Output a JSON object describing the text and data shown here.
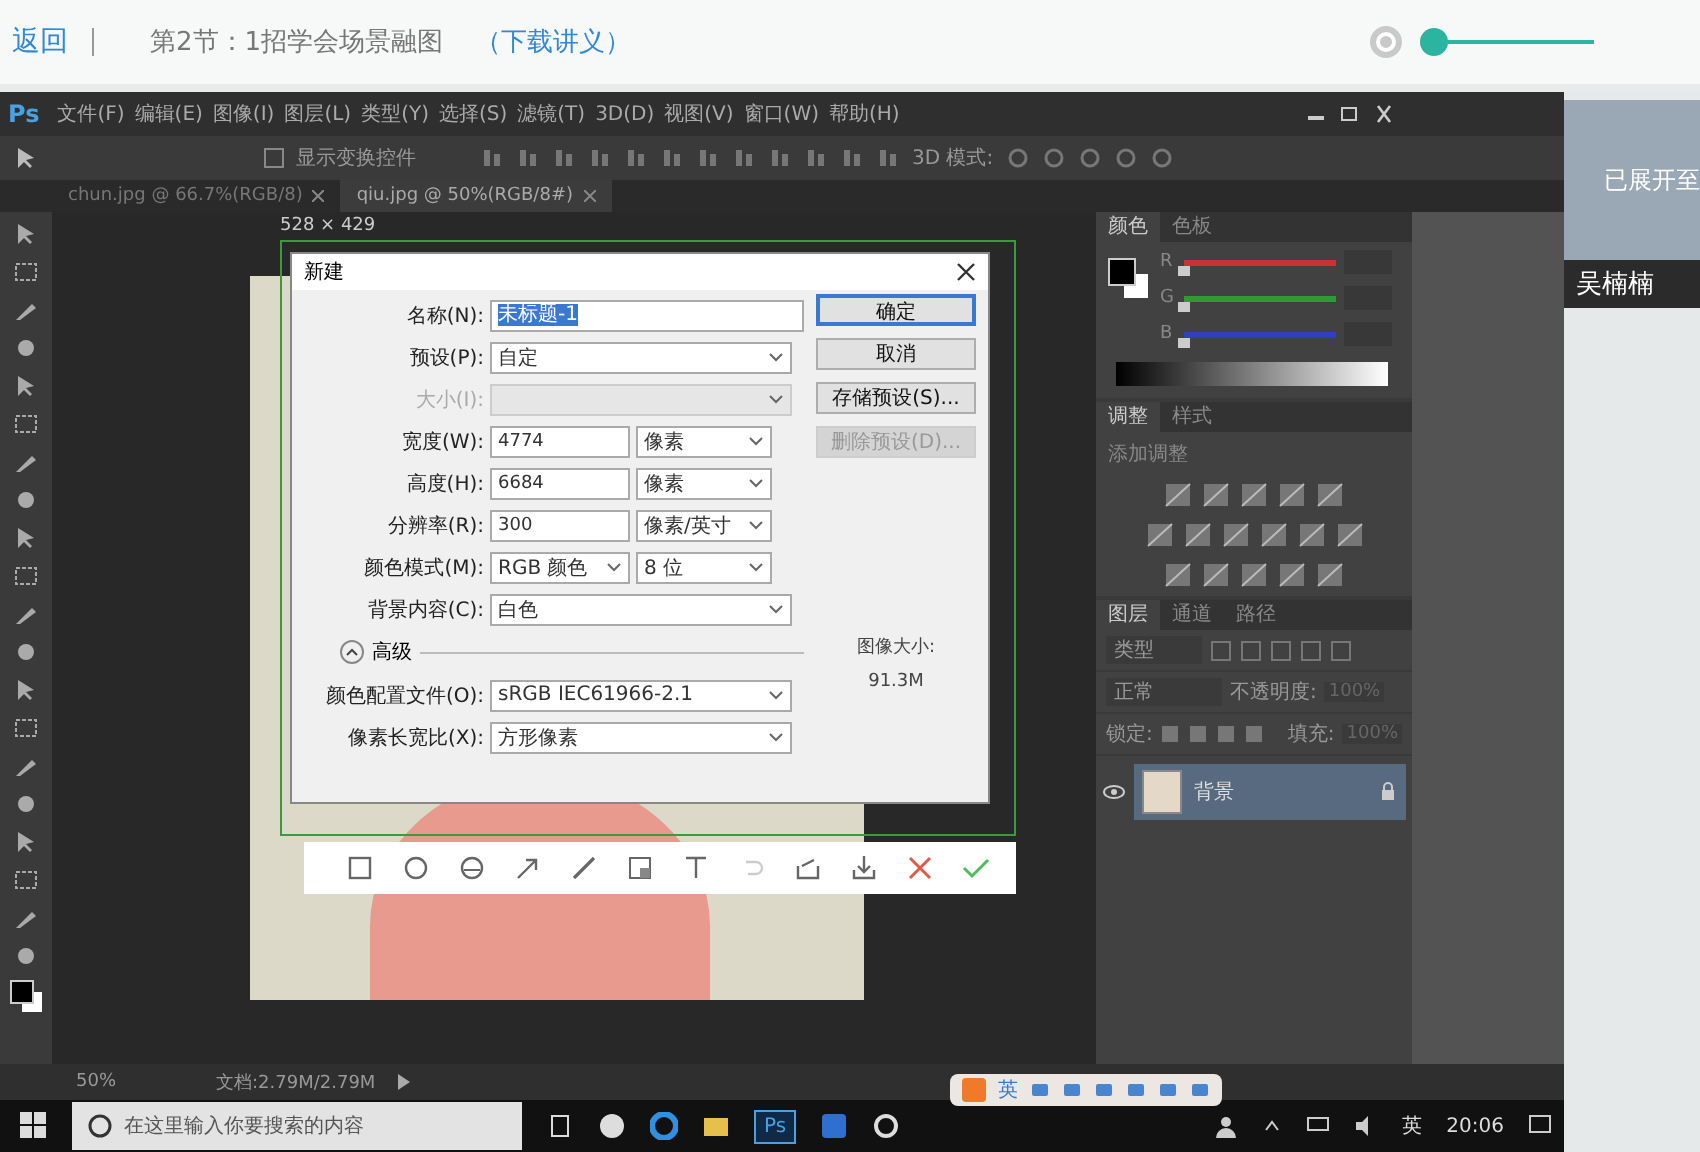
{
  "header": {
    "back": "返回",
    "lesson_title": "第2节：1招学会场景融图",
    "download_link": "（下载讲义）",
    "volume": {
      "level": 0
    }
  },
  "photoshop": {
    "logo": "Ps",
    "menu": [
      "文件(F)",
      "编辑(E)",
      "图像(I)",
      "图层(L)",
      "类型(Y)",
      "选择(S)",
      "滤镜(T)",
      "3D(D)",
      "视图(V)",
      "窗口(W)",
      "帮助(H)"
    ],
    "options_bar": {
      "transform_label": "显示变换控件",
      "transform_checked": false,
      "mode_3d": "3D 模式:"
    },
    "document_tabs": [
      {
        "label": "chun.jpg @ 66.7%(RGB/8)",
        "selected": false
      },
      {
        "label": "qiu.jpg @ 50%(RGB/8#)",
        "selected": true
      }
    ],
    "selection_size": "528 × 429",
    "new_dialog": {
      "title": "新建",
      "rows": [
        {
          "kind": "name",
          "label": "名称(N):",
          "value": "未标题-1",
          "disabled": false
        },
        {
          "kind": "select",
          "label": "预设(P):",
          "value": "自定",
          "disabled": false
        },
        {
          "kind": "select",
          "label": "大小(I):",
          "disabled": true
        },
        {
          "kind": "input_unit",
          "label": "宽度(W):",
          "value": "4774",
          "unit": "像素",
          "disabled": false
        },
        {
          "kind": "input_unit",
          "label": "高度(H):",
          "value": "6684",
          "unit": "像素",
          "disabled": false
        },
        {
          "kind": "input_unit",
          "label": "分辨率(R):",
          "value": "300",
          "unit": "像素/英寸",
          "disabled": false
        },
        {
          "kind": "select_pair",
          "label": "颜色模式(M):",
          "value": "RGB 颜色",
          "unit": "8 位",
          "disabled": false
        },
        {
          "kind": "select",
          "label": "背景内容(C):",
          "value": "白色",
          "disabled": false
        }
      ],
      "advanced": {
        "label": "高级",
        "expanded": true
      },
      "advanced_rows": [
        {
          "kind": "select",
          "label": "颜色配置文件(O):",
          "value": "sRGB IEC61966-2.1",
          "disabled": false
        },
        {
          "kind": "select",
          "label": "像素长宽比(X):",
          "value": "方形像素",
          "disabled": false
        }
      ],
      "buttons": [
        {
          "label": "确定",
          "default": true,
          "disabled": false
        },
        {
          "label": "取消",
          "default": false,
          "disabled": false
        },
        {
          "label": "存储预设(S)...",
          "default": false,
          "disabled": false
        },
        {
          "label": "删除预设(D)...",
          "default": false,
          "disabled": true
        }
      ],
      "image_size": {
        "label": "图像大小:",
        "value": "91.3M"
      }
    },
    "color_panel": {
      "tabs": [
        {
          "label": "颜色",
          "selected": true
        },
        {
          "label": "色板",
          "selected": false
        }
      ],
      "channels": [
        {
          "label": "R",
          "color": "#c83232",
          "level": 0
        },
        {
          "label": "G",
          "color": "#2f9a3a",
          "level": 0
        },
        {
          "label": "B",
          "color": "#2f3fc0",
          "level": 0
        }
      ]
    },
    "adjustments_panel": {
      "tabs": [
        {
          "label": "调整",
          "selected": true
        },
        {
          "label": "样式",
          "selected": false
        }
      ],
      "heading": "添加调整"
    },
    "layers_panel": {
      "tabs": [
        {
          "label": "图层",
          "selected": true
        },
        {
          "label": "通道",
          "selected": false
        },
        {
          "label": "路径",
          "selected": false
        }
      ],
      "filter": "类型",
      "blend_mode": "正常",
      "opacity_label": "不透明度:",
      "opacity": "100%",
      "lock_label": "锁定:",
      "fill_label": "填充:",
      "fill": "100%",
      "layers": [
        {
          "name": "背景",
          "visible": true,
          "selected": true
        }
      ]
    },
    "status_bar": {
      "zoom": "50%",
      "document": "文档:2.79M/2.79M"
    }
  },
  "screenshot_toolbar": [
    {
      "kind": "rectangle"
    },
    {
      "kind": "ellipse"
    },
    {
      "kind": "mosaic"
    },
    {
      "kind": "arrow"
    },
    {
      "kind": "pen"
    },
    {
      "kind": "blur"
    },
    {
      "kind": "text"
    },
    {
      "kind": "undo"
    },
    {
      "kind": "share"
    },
    {
      "kind": "save"
    },
    {
      "kind": "cancel"
    },
    {
      "kind": "confirm"
    }
  ],
  "ime_bar": {
    "label": "英"
  },
  "taskbar": {
    "search_placeholder": "在这里输入你要搜索的内容",
    "ps_label": "Ps",
    "ime": "英",
    "time": "20:06"
  },
  "sidebar": {
    "camera_caption": "已展开至",
    "presenter": "吴楠楠"
  }
}
